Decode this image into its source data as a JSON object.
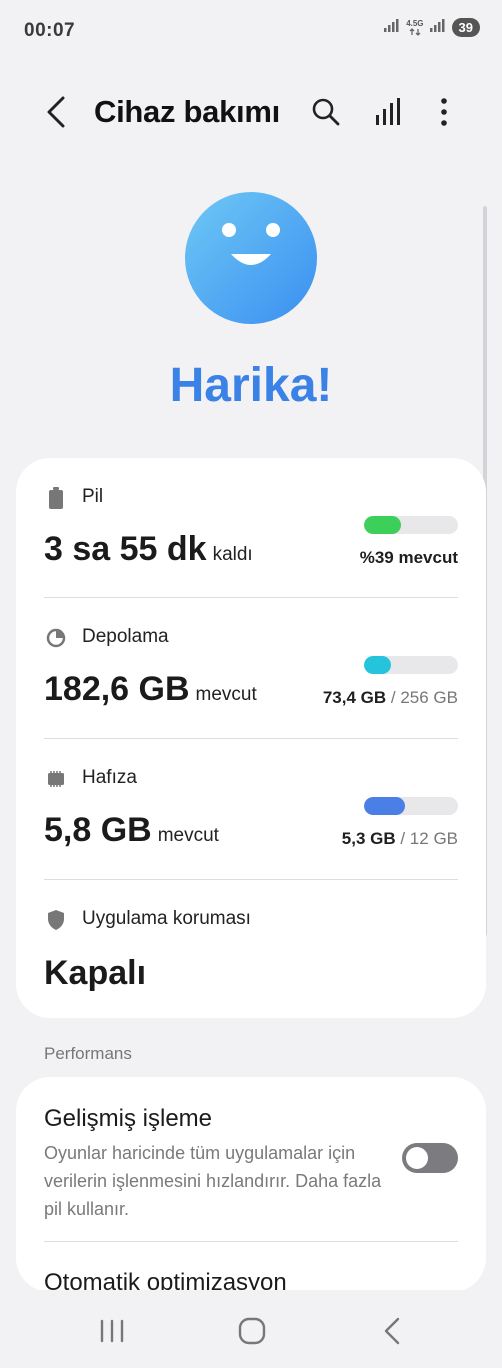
{
  "status_bar": {
    "time": "00:07",
    "network_label": "4.5G",
    "battery_level": "39",
    "icons": [
      "signal-icon",
      "data-arrows-icon",
      "signal-icon",
      "battery-icon"
    ]
  },
  "header": {
    "title": "Cihaz bakımı",
    "icons": [
      "back-arrow-icon",
      "search-icon",
      "bar-chart-icon",
      "more-vert-icon"
    ]
  },
  "status": {
    "face_icon": "smiley-face-icon",
    "label": "Harika!",
    "accent_color": "#3b82e6"
  },
  "battery": {
    "label": "Pil",
    "icon": "battery-icon",
    "value": "3 sa 55 dk",
    "unit": "kaldı",
    "detail": "%39 mevcut",
    "fill_fraction": 0.39,
    "bar_color": "#3ccf5a"
  },
  "storage": {
    "label": "Depolama",
    "icon": "pie-chart-icon",
    "value": "182,6 GB",
    "unit": "mevcut",
    "used": "73,4 GB",
    "total": "/ 256 GB",
    "fill_fraction": 0.29,
    "bar_color": "#26c3dd"
  },
  "memory": {
    "label": "Hafıza",
    "icon": "memory-chip-icon",
    "value": "5,8 GB",
    "unit": "mevcut",
    "used": "5,3 GB",
    "total": "/ 12 GB",
    "fill_fraction": 0.44,
    "bar_color": "#4a7fe6"
  },
  "app_protection": {
    "label": "Uygulama koruması",
    "icon": "shield-icon",
    "value": "Kapalı"
  },
  "performance": {
    "section_label": "Performans",
    "enhanced_processing": {
      "title": "Gelişmiş işleme",
      "description": "Oyunlar haricinde tüm uygulamalar için verilerin işlenmesini hızlandırır. Daha fazla pil kullanır.",
      "enabled": false
    },
    "next_item": "Otomatik optimizasyon"
  },
  "nav": {
    "icons": [
      "recent-apps-icon",
      "home-icon",
      "back-icon"
    ]
  }
}
